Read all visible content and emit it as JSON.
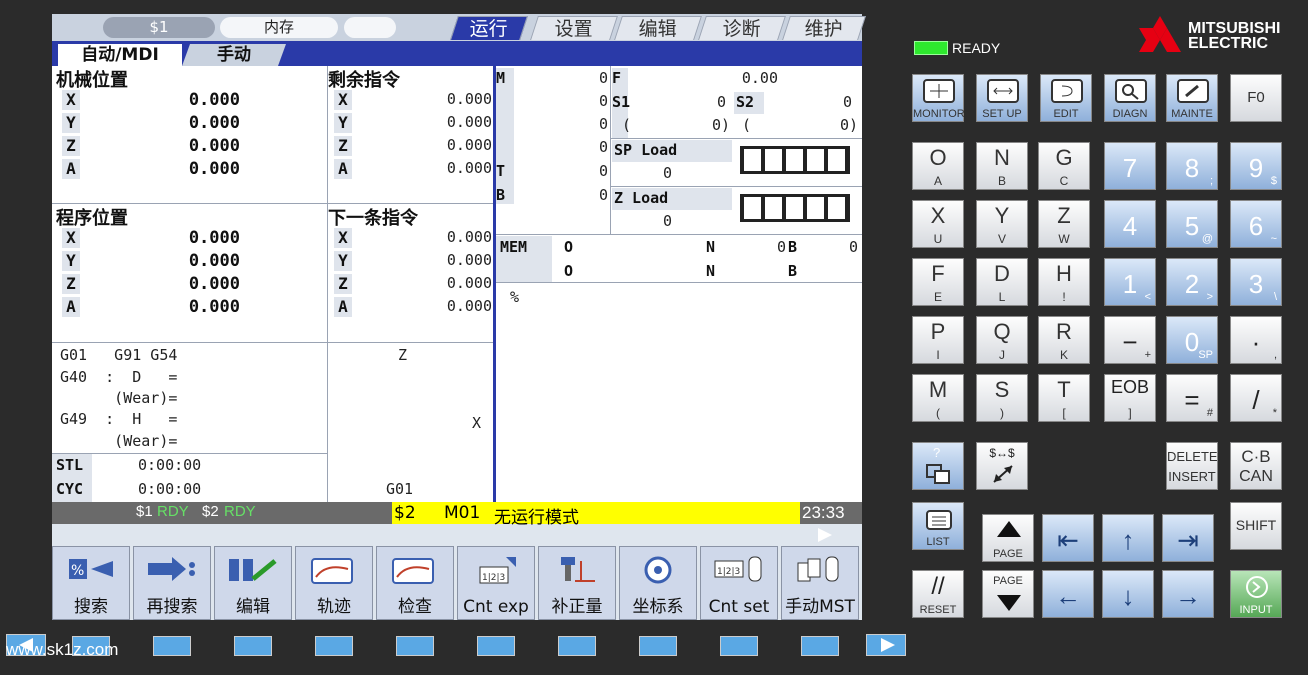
{
  "top_tabs": {
    "system": "$1",
    "memory": "内存",
    "blank": "",
    "run": "运行",
    "setup": "设置",
    "edit": "编辑",
    "diag": "诊断",
    "maint": "维护"
  },
  "sub_tabs": {
    "auto": "自动/MDI",
    "manual": "手动"
  },
  "machine_pos": {
    "title": "机械位置",
    "rows": [
      {
        "axis": "X",
        "value": "0.000"
      },
      {
        "axis": "Y",
        "value": "0.000"
      },
      {
        "axis": "Z",
        "value": "0.000"
      },
      {
        "axis": "A",
        "value": "0.000"
      }
    ]
  },
  "remaining": {
    "title": "剩余指令",
    "rows": [
      {
        "axis": "X",
        "value": "0.000"
      },
      {
        "axis": "Y",
        "value": "0.000"
      },
      {
        "axis": "Z",
        "value": "0.000"
      },
      {
        "axis": "A",
        "value": "0.000"
      }
    ]
  },
  "program_pos": {
    "title": "程序位置",
    "rows": [
      {
        "axis": "X",
        "value": "0.000"
      },
      {
        "axis": "Y",
        "value": "0.000"
      },
      {
        "axis": "Z",
        "value": "0.000"
      },
      {
        "axis": "A",
        "value": "0.000"
      }
    ]
  },
  "next_cmd": {
    "title": "下一条指令",
    "rows": [
      {
        "axis": "X",
        "value": "0.000"
      },
      {
        "axis": "Y",
        "value": "0.000"
      },
      {
        "axis": "Z",
        "value": "0.000"
      },
      {
        "axis": "A",
        "value": "0.000"
      }
    ]
  },
  "mstb": {
    "m": "M",
    "m_vals": [
      "0",
      "0",
      "0",
      "0"
    ],
    "t": "T",
    "t_val": "0",
    "b": "B",
    "b_val": "0"
  },
  "feed": {
    "f": "F",
    "f_val": "0.00",
    "s1": "S1",
    "s1_val": "0",
    "s2": "S2",
    "s2_val": "0",
    "paren1": "(",
    "paren1_val": "0)",
    "paren2": "(",
    "paren2_val": "0)"
  },
  "load": {
    "sp": "SP Load",
    "sp_val": "0",
    "z": "Z Load",
    "z_val": "0"
  },
  "mem": {
    "label": "MEM",
    "o1": "O",
    "n1": "N",
    "n1_val": "0",
    "b1": "B",
    "b1_val": "0",
    "o2": "O",
    "n2": "N",
    "b2": "B",
    "percent": "%"
  },
  "modal": {
    "l1": "G01   G91 G54",
    "l2": "G40  :  D   =",
    "l3": "      (Wear)=",
    "l4": "G49  :  H   =",
    "l5": "      (Wear)="
  },
  "graph": {
    "z": "Z",
    "x": "X",
    "g": "G01"
  },
  "time": {
    "stl": "STL",
    "stl_val": "0:00:00",
    "cyc": "CYC",
    "cyc_val": "0:00:00"
  },
  "status": {
    "s1": "$1",
    "rdy1": "RDY",
    "s2": "$2",
    "rdy2": "RDY",
    "msg_s": "$2",
    "msg_m": "M01",
    "msg": "无运行模式",
    "clock": "23:33"
  },
  "menu": [
    "搜索",
    "再搜索",
    "编辑",
    "轨迹",
    "检查",
    "Cnt exp",
    "补正量",
    "坐标系",
    "Cnt set",
    "手动MST"
  ],
  "ready": "READY",
  "brand1": "MITSUBISHI",
  "brand2": "ELECTRIC",
  "func_keys": [
    {
      "icon": "monitor-icon",
      "label": "MONITOR"
    },
    {
      "icon": "setup-icon",
      "label": "SET UP"
    },
    {
      "icon": "edit-icon",
      "label": "EDIT"
    },
    {
      "icon": "diagn-icon",
      "label": "DIAGN"
    },
    {
      "icon": "mainte-icon",
      "label": "MAINTE"
    },
    {
      "label": "F0"
    }
  ],
  "letters": [
    [
      {
        "m": "O",
        "s": "A"
      },
      {
        "m": "N",
        "s": "B"
      },
      {
        "m": "G",
        "s": "C"
      }
    ],
    [
      {
        "m": "X",
        "s": "U"
      },
      {
        "m": "Y",
        "s": "V"
      },
      {
        "m": "Z",
        "s": "W"
      }
    ],
    [
      {
        "m": "F",
        "s": "E"
      },
      {
        "m": "D",
        "s": "L"
      },
      {
        "m": "H",
        "s": "!"
      }
    ],
    [
      {
        "m": "P",
        "s": "I"
      },
      {
        "m": "Q",
        "s": "J"
      },
      {
        "m": "R",
        "s": "K"
      }
    ],
    [
      {
        "m": "M",
        "s": "("
      },
      {
        "m": "S",
        "s": ")"
      },
      {
        "m": "T",
        "s": "["
      }
    ]
  ],
  "numbers": [
    [
      {
        "m": "7",
        "s": ""
      },
      {
        "m": "8",
        "s": ";"
      },
      {
        "m": "9",
        "s": "$"
      }
    ],
    [
      {
        "m": "4",
        "s": ""
      },
      {
        "m": "5",
        "s": "@"
      },
      {
        "m": "6",
        "s": "~"
      }
    ],
    [
      {
        "m": "1",
        "s": "<"
      },
      {
        "m": "2",
        "s": ">"
      },
      {
        "m": "3",
        "s": "\\"
      }
    ],
    [
      {
        "m": "−",
        "s": "+"
      },
      {
        "m": "0",
        "s": "SP"
      },
      {
        "m": "·",
        "s": ","
      }
    ],
    [
      {
        "m": "EOB",
        "s": "]"
      },
      {
        "m": "=",
        "s": "#"
      },
      {
        "m": "/",
        "s": "*"
      }
    ]
  ],
  "keys": {
    "help": "?",
    "dollar": "$↔$",
    "delete": "DELETE",
    "insert": "INSERT",
    "cb": "C·B",
    "can": "CAN",
    "list": "LIST",
    "page": "PAGE",
    "shift": "SHIFT",
    "reset": "RESET",
    "input": "INPUT"
  },
  "watermark": "www.sk1z.com"
}
